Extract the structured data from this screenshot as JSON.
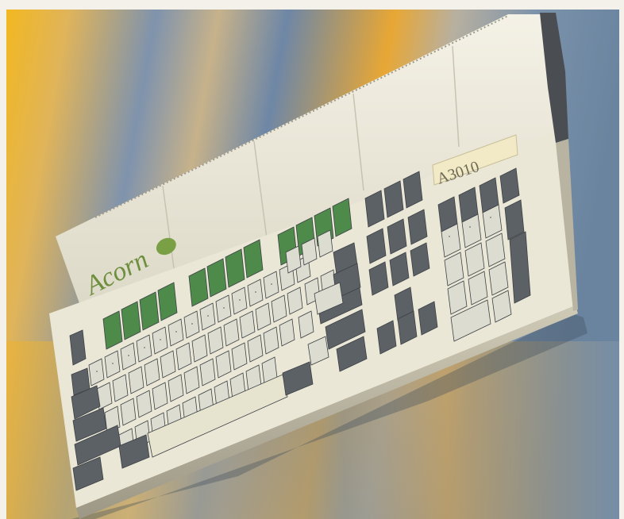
{
  "image": {
    "subject": "keyboard-computer",
    "brand_logo_text": "Acorn",
    "model_label_text": "A3010",
    "colors": {
      "frame": "#f4f1ea",
      "bg_gold": "#e8a91e",
      "bg_blue": "#6c8aa8",
      "case": "#ece8d8",
      "key_light": "#dcdcd0",
      "key_dark": "#5c6166",
      "key_green": "#4e8a4a"
    }
  }
}
